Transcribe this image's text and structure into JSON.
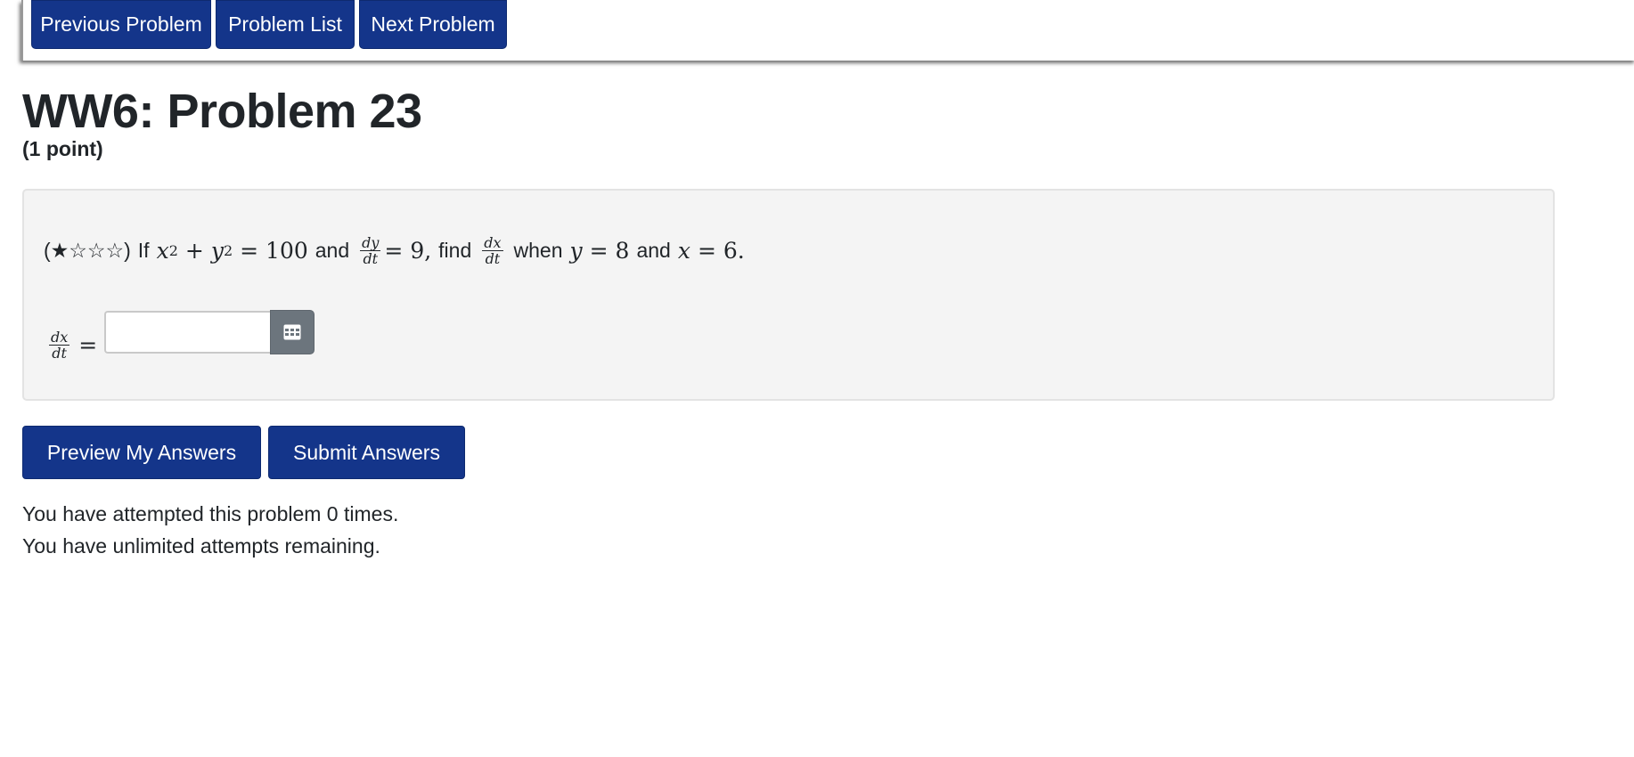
{
  "nav": {
    "previous_label": "Previous Problem",
    "list_label": "Problem List",
    "next_label": "Next Problem"
  },
  "problem": {
    "title": "WW6: Problem 23",
    "points": "(1 point)",
    "difficulty_stars": "(★☆☆☆)",
    "text_if": "If",
    "eq1_lhs_x": "x",
    "eq1_plus": "+",
    "eq1_y": "y",
    "exp2": "2",
    "eq1_rhs": "= 100",
    "text_and": "and",
    "dy": "dy",
    "dt": "dt",
    "eq2_rhs": "= 9,",
    "text_find": "find",
    "dx": "dx",
    "text_when": "when",
    "cond_y": "y",
    "cond_y_val": "= 8",
    "text_and2": "and",
    "cond_x": "x",
    "cond_x_val": "= 6.",
    "answer_equals": "="
  },
  "answer": {
    "value": "",
    "placeholder": ""
  },
  "actions": {
    "preview_label": "Preview My Answers",
    "submit_label": "Submit Answers"
  },
  "status": {
    "attempts_line": "You have attempted this problem 0 times.",
    "remaining_line": "You have unlimited attempts remaining."
  },
  "colors": {
    "primary_button": "#14358a",
    "input_group_button": "#6c757d",
    "problem_background": "#f4f4f4"
  },
  "icons": {
    "equation_editor": "grid-icon"
  }
}
